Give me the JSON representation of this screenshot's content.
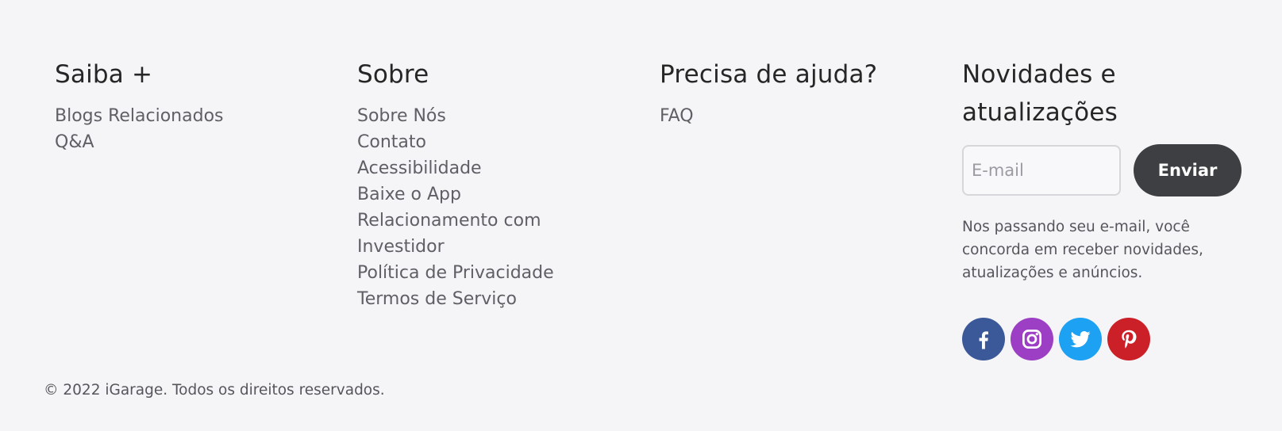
{
  "columns": {
    "learn": {
      "title": "Saiba +",
      "links": [
        "Blogs Relacionados",
        "Q&A"
      ]
    },
    "about": {
      "title": "Sobre",
      "links": [
        "Sobre Nós",
        "Contato",
        "Acessibilidade",
        "Baixe o App",
        "Relacionamento com",
        "Investidor",
        "Política de Privacidade",
        "Termos de Serviço"
      ]
    },
    "help": {
      "title": "Precisa de ajuda?",
      "links": [
        "FAQ"
      ]
    },
    "newsletter": {
      "title_line1": "Novidades e",
      "title_line2": "atualizações",
      "email_placeholder": "E-mail",
      "email_value": "",
      "send_label": "Enviar",
      "note_line1": "Nos passando seu e-mail, você",
      "note_line2": "concorda em receber novidades,",
      "note_line3": "atualizações e anúncios."
    }
  },
  "social": [
    {
      "name": "facebook",
      "icon": "facebook-icon",
      "color": "#3b5998"
    },
    {
      "name": "instagram",
      "icon": "instagram-icon",
      "color": "#9c3fc4"
    },
    {
      "name": "twitter",
      "icon": "twitter-icon",
      "color": "#1da1f2"
    },
    {
      "name": "pinterest",
      "icon": "pinterest-icon",
      "color": "#cb2027"
    }
  ],
  "copyright": "© 2022 iGarage. Todos os direitos reservados."
}
